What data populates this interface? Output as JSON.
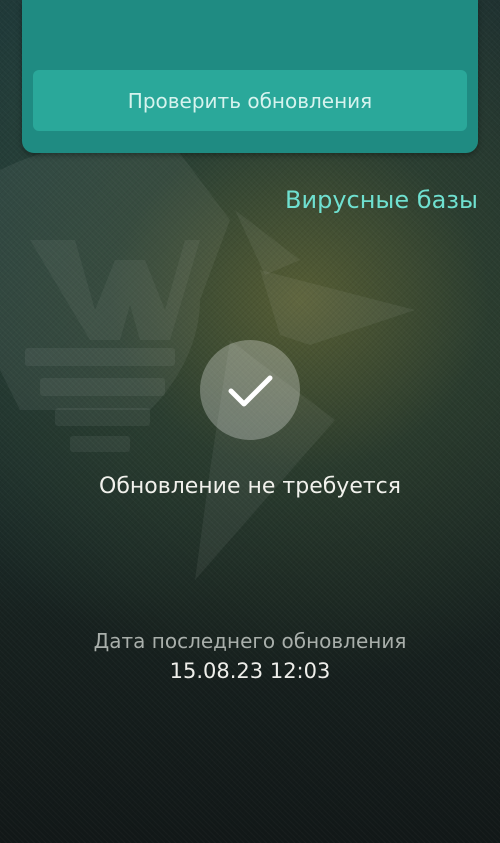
{
  "header": {
    "check_updates_label": "Проверить обновления"
  },
  "links": {
    "virus_bases_label": "Вирусные базы"
  },
  "status": {
    "icon": "checkmark-icon",
    "message": "Обновление не требуется"
  },
  "last_update": {
    "label": "Дата последнего обновления",
    "value": "15.08.23 12:03"
  },
  "colors": {
    "card": "#1f8b82",
    "button": "#2aa89a",
    "link": "#6fe0d0"
  }
}
